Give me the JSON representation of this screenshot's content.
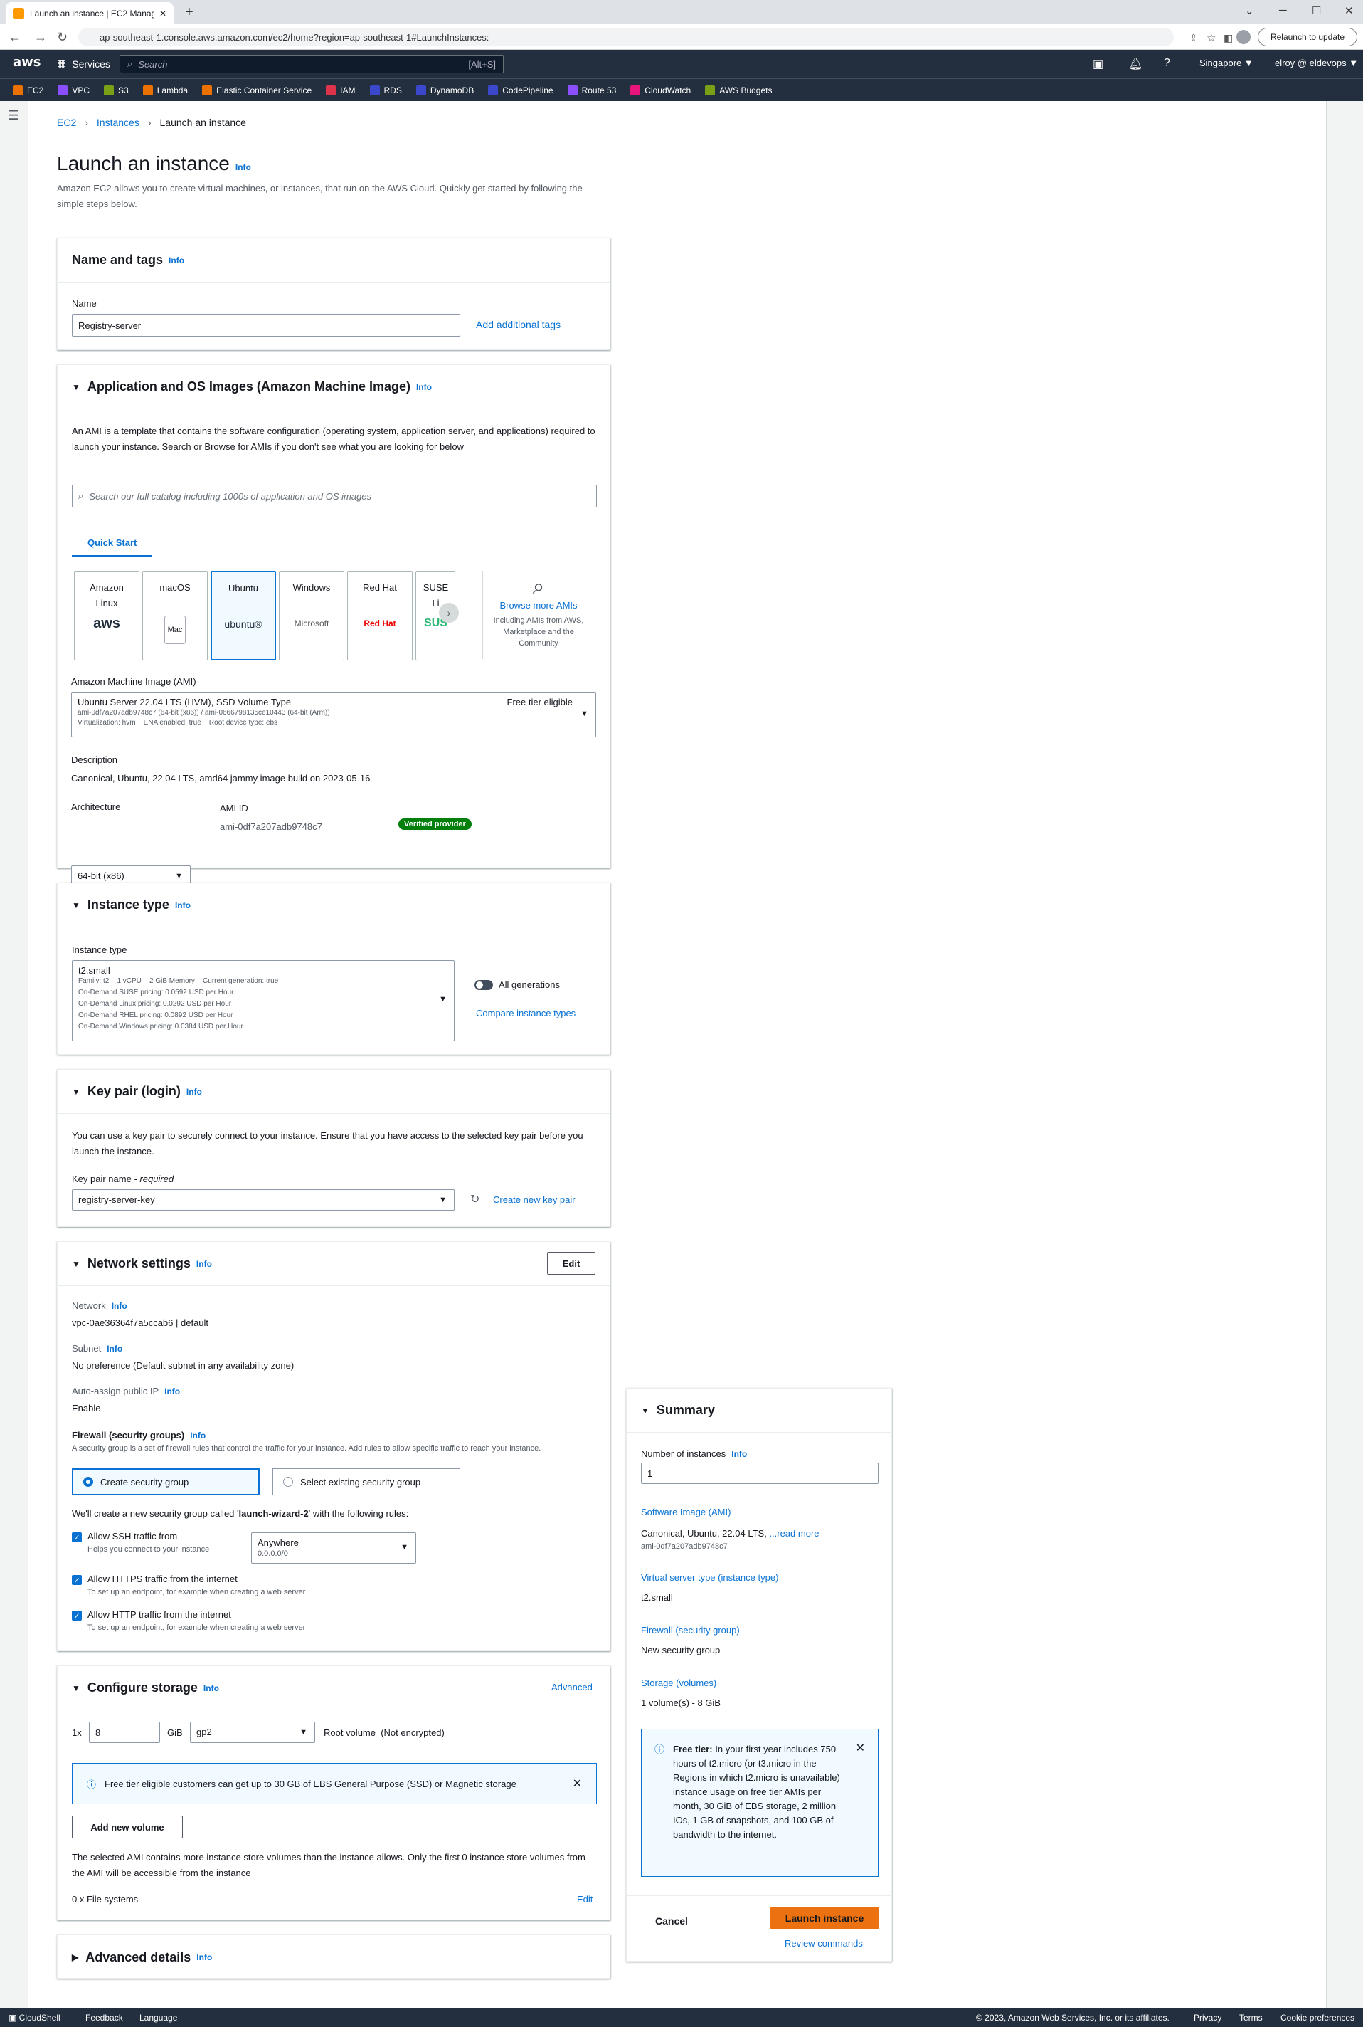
{
  "browser": {
    "tab_title": "Launch an instance | EC2 Manag…",
    "url": "ap-southeast-1.console.aws.amazon.com/ec2/home?region=ap-southeast-1#LaunchInstances:",
    "relaunch": "Relaunch to update"
  },
  "aws": {
    "logo": "aws",
    "services": "Services",
    "search_placeholder": "Search",
    "search_shortcut": "[Alt+S]",
    "region": "Singapore ▼",
    "user": "elroy @ eldevops ▼"
  },
  "favorites": [
    {
      "label": "EC2",
      "color": "#ed7100"
    },
    {
      "label": "VPC",
      "color": "#8c4fff"
    },
    {
      "label": "S3",
      "color": "#7aa116"
    },
    {
      "label": "Lambda",
      "color": "#ed7100"
    },
    {
      "label": "Elastic Container Service",
      "color": "#ed7100"
    },
    {
      "label": "IAM",
      "color": "#dd344c"
    },
    {
      "label": "RDS",
      "color": "#3b48cc"
    },
    {
      "label": "DynamoDB",
      "color": "#3b48cc"
    },
    {
      "label": "CodePipeline",
      "color": "#3b48cc"
    },
    {
      "label": "Route 53",
      "color": "#8c4fff"
    },
    {
      "label": "CloudWatch",
      "color": "#e7157b"
    },
    {
      "label": "AWS Budgets",
      "color": "#7aa116"
    }
  ],
  "breadcrumb": {
    "ec2": "EC2",
    "instances": "Instances",
    "current": "Launch an instance"
  },
  "page": {
    "title": "Launch an instance",
    "info": "Info",
    "description": "Amazon EC2 allows you to create virtual machines, or instances, that run on the AWS Cloud. Quickly get started by following the simple steps below."
  },
  "name_tags": {
    "title": "Name and tags",
    "info": "Info",
    "name_label": "Name",
    "name_value": "Registry-server",
    "add_tags": "Add additional tags"
  },
  "ami": {
    "title": "Application and OS Images (Amazon Machine Image)",
    "info": "Info",
    "desc": "An AMI is a template that contains the software configuration (operating system, application server, and applications) required to launch your instance. Search or Browse for AMIs if you don't see what you are looking for below",
    "search_placeholder": "Search our full catalog including 1000s of application and OS images",
    "tab": "Quick Start",
    "tiles": [
      {
        "name": "Amazon Linux",
        "logo": "aws"
      },
      {
        "name": "macOS",
        "logo": "Mac"
      },
      {
        "name": "Ubuntu",
        "logo": "ubuntu®"
      },
      {
        "name": "Windows",
        "logo": "Microsoft"
      },
      {
        "name": "Red Hat",
        "logo": "Red Hat"
      },
      {
        "name": "SUSE Li",
        "logo": "SUS"
      }
    ],
    "browse_more": "Browse more AMIs",
    "browse_desc": "Including AMIs from AWS, Marketplace and the Community",
    "ami_label": "Amazon Machine Image (AMI)",
    "ami_name": "Ubuntu Server 22.04 LTS (HVM), SSD Volume Type",
    "ami_ids": "ami-0df7a207adb9748c7 (64-bit (x86)) / ami-0666798135ce10443 (64-bit (Arm))",
    "ami_meta": "Virtualization: hvm    ENA enabled: true    Root device type: ebs",
    "free_tier": "Free tier eligible",
    "desc_label": "Description",
    "desc_value": "Canonical, Ubuntu, 22.04 LTS, amd64 jammy image build on 2023-05-16",
    "arch_label": "Architecture",
    "arch_value": "64-bit (x86)",
    "amiid_label": "AMI ID",
    "amiid_value": "ami-0df7a207adb9748c7",
    "verified": "Verified provider"
  },
  "instance_type": {
    "title": "Instance type",
    "info": "Info",
    "label": "Instance type",
    "value": "t2.small",
    "specs": "Family: t2    1 vCPU    2 GiB Memory    Current generation: true",
    "p1": "On-Demand SUSE pricing: 0.0592 USD per Hour",
    "p2": "On-Demand Linux pricing: 0.0292 USD per Hour",
    "p3": "On-Demand RHEL pricing: 0.0892 USD per Hour",
    "p4": "On-Demand Windows pricing: 0.0384 USD per Hour",
    "all_gen": "All generations",
    "compare": "Compare instance types"
  },
  "key_pair": {
    "title": "Key pair (login)",
    "info": "Info",
    "desc": "You can use a key pair to securely connect to your instance. Ensure that you have access to the selected key pair before you launch the instance.",
    "label": "Key pair name",
    "required": " - required",
    "value": "registry-server-key",
    "create": "Create new key pair"
  },
  "network": {
    "title": "Network settings",
    "info": "Info",
    "edit": "Edit",
    "network_label": "Network",
    "network_value": "vpc-0ae36364f7a5ccab6 | default",
    "subnet_label": "Subnet",
    "subnet_value": "No preference (Default subnet in any availability zone)",
    "ip_label": "Auto-assign public IP",
    "ip_value": "Enable",
    "fw_label": "Firewall (security groups)",
    "fw_desc": "A security group is a set of firewall rules that control the traffic for your instance. Add rules to allow specific traffic to reach your instance.",
    "create_sg": "Create security group",
    "select_sg": "Select existing security group",
    "rule_intro_a": "We'll create a new security group called '",
    "rule_sg_name": "launch-wizard-2",
    "rule_intro_b": "' with the following rules:",
    "ssh": "Allow SSH traffic from",
    "ssh_help": "Helps you connect to your instance",
    "ssh_src": "Anywhere",
    "ssh_cidr": "0.0.0.0/0",
    "https": "Allow HTTPS traffic from the internet",
    "https_help": "To set up an endpoint, for example when creating a web server",
    "http": "Allow HTTP traffic from the internet",
    "http_help": "To set up an endpoint, for example when creating a web server"
  },
  "storage": {
    "title": "Configure storage",
    "info": "Info",
    "advanced": "Advanced",
    "count": "1x",
    "size": "8",
    "unit": "GiB",
    "type": "gp2",
    "root": "Root volume  (Not encrypted)",
    "free_msg": "Free tier eligible customers can get up to 30 GB of EBS General Purpose (SSD) or Magnetic storage",
    "add_vol": "Add new volume",
    "note": "The selected AMI contains more instance store volumes than the instance allows. Only the first 0 instance store volumes from the AMI will be accessible from the instance",
    "fs": "0 x File systems",
    "edit": "Edit"
  },
  "advanced": {
    "title": "Advanced details",
    "info": "Info"
  },
  "summary": {
    "title": "Summary",
    "num_label": "Number of instances",
    "info": "Info",
    "num_value": "1",
    "sw_label": "Software Image (AMI)",
    "sw_value": "Canonical, Ubuntu, 22.04 LTS, ",
    "read_more": "...read more",
    "sw_id": "ami-0df7a207adb9748c7",
    "vs_label": "Virtual server type (instance type)",
    "vs_value": "t2.small",
    "fw_label": "Firewall (security group)",
    "fw_value": "New security group",
    "st_label": "Storage (volumes)",
    "st_value": "1 volume(s) - 8 GiB",
    "ft_title": "Free tier:",
    "ft_body": " In your first year includes 750 hours of t2.micro (or t3.micro in the Regions in which t2.micro is unavailable) instance usage on free tier AMIs per month, 30 GiB of EBS storage, 2 million IOs, 1 GB of snapshots, and 100 GB of bandwidth to the internet.",
    "cancel": "Cancel",
    "launch": "Launch instance",
    "review": "Review commands"
  },
  "footer": {
    "cloudshell": "CloudShell",
    "feedback": "Feedback",
    "language": "Language",
    "copyright": "© 2023, Amazon Web Services, Inc. or its affiliates.",
    "privacy": "Privacy",
    "terms": "Terms",
    "cookies": "Cookie preferences"
  }
}
